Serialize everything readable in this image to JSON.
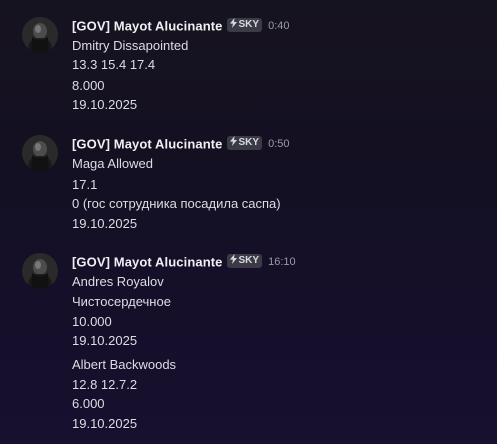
{
  "messages": [
    {
      "author": "[GOV] Mayot Alucinante",
      "tag": "SKY",
      "time": "0:40",
      "lines": [
        "Dmitry Dissapointed",
        "13.3 15.4 17.4",
        "8.000",
        "19.10.2025"
      ]
    },
    {
      "author": "[GOV] Mayot Alucinante",
      "tag": "SKY",
      "time": "0:50",
      "lines": [
        "Maga Allowed",
        "17.1",
        "0 (гос сотрудника посадила саспа)",
        "19.10.2025"
      ]
    },
    {
      "author": "[GOV] Mayot Alucinante",
      "tag": "SKY",
      "time": "16:10",
      "lines": [
        "Andres Royalov",
        "Чистосердечное",
        "10.000",
        "19.10.2025",
        "Albert Backwoods",
        "12.8 12.7.2",
        "6.000",
        "19.10.2025"
      ]
    }
  ],
  "colors": {
    "background": "#151024",
    "username": "#f0f0f3",
    "text": "#dcdde3",
    "timestamp": "#9a9ba6",
    "badge_bg": "#3a3b44"
  },
  "icons": {
    "avatar": "avatar-image",
    "tag": "lightning-bolt-icon"
  }
}
